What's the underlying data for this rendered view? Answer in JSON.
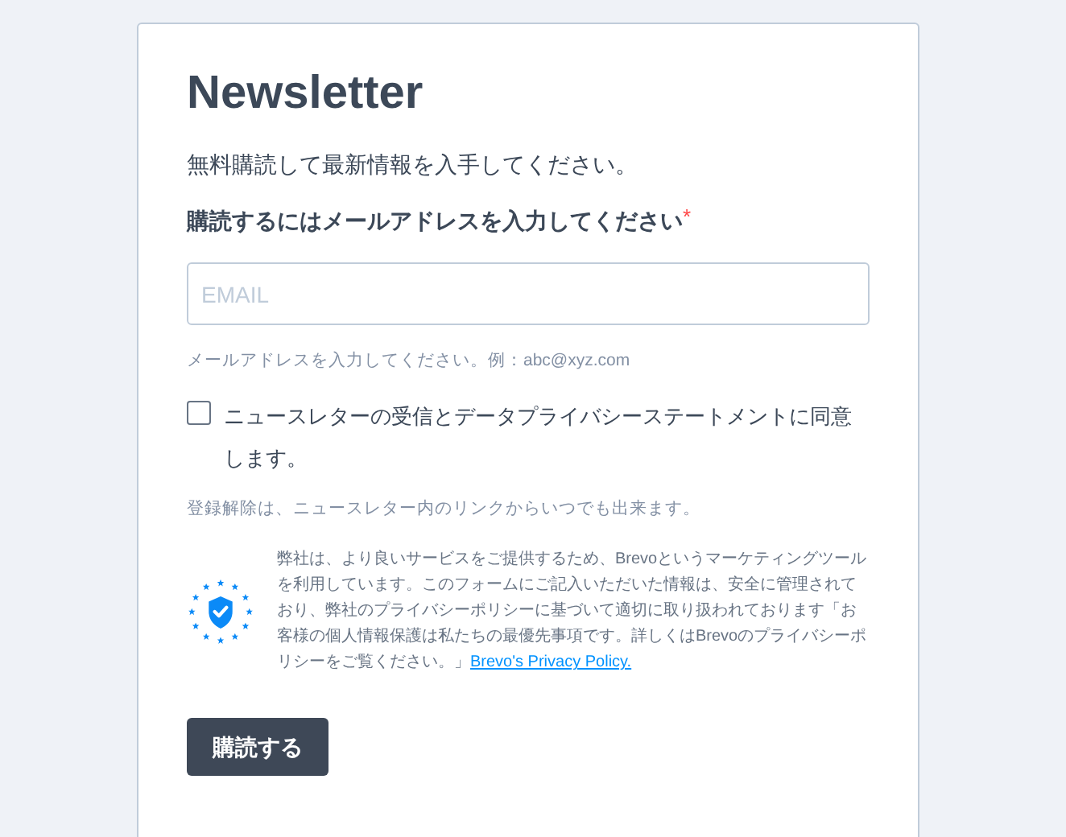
{
  "title": "Newsletter",
  "subtitle": "無料購読して最新情報を入手してください。",
  "email_label": "購読するにはメールアドレスを入力してください",
  "required_mark": "*",
  "email_field": {
    "placeholder": "EMAIL"
  },
  "email_help": "メールアドレスを入力してください。例：abc@xyz.com",
  "consent": {
    "label": "ニュースレターの受信とデータプライバシーステートメントに同意します。",
    "checked": false
  },
  "unsubscribe_note": "登録解除は、ニュースレター内のリンクからいつでも出来ます。",
  "privacy": {
    "text": "弊社は、より良いサービスをご提供するため、Brevoというマーケティングツールを利用しています。このフォームにご記入いただいた情報は、安全に管理されており、弊社のプライバシーポリシーに基づいて適切に取り扱われております「お客様の個人情報保護は私たちの最優先事項です。詳しくはBrevoのプライバシーポリシーをご覧ください。」",
    "link": "Brevo's Privacy Policy."
  },
  "submit_button": "購読する"
}
